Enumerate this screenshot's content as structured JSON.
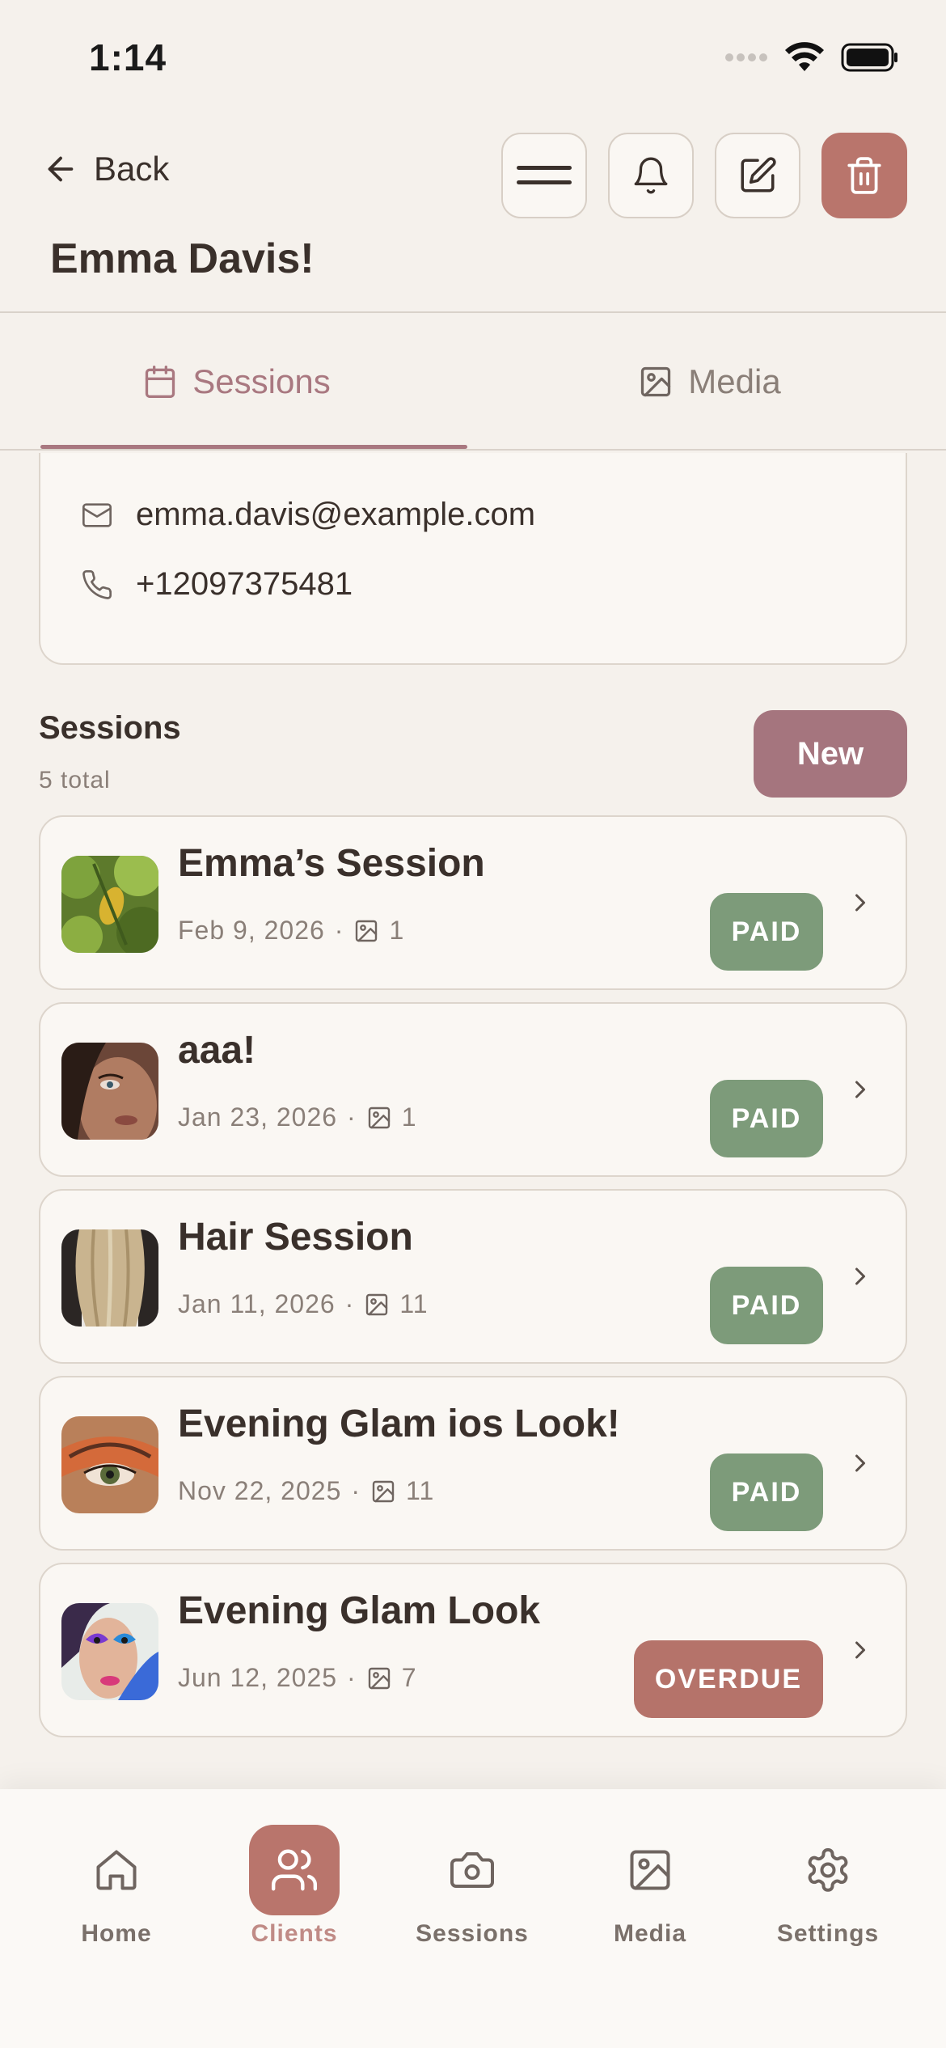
{
  "status_bar": {
    "time": "1:14"
  },
  "header": {
    "back_label": "Back",
    "title": "Emma Davis!",
    "actions": [
      "menu-icon",
      "bell-icon",
      "edit-icon",
      "trash-icon"
    ]
  },
  "tabs": [
    {
      "label": "Sessions",
      "icon": "calendar-icon",
      "active": true
    },
    {
      "label": "Media",
      "icon": "image-icon",
      "active": false
    }
  ],
  "contact": {
    "email": "emma.davis@example.com",
    "phone": "+12097375481"
  },
  "sessions_section": {
    "title": "Sessions",
    "count_label": "5 total",
    "new_button": "New"
  },
  "sessions": [
    {
      "title": "Emma’s Session",
      "date": "Feb 9, 2026",
      "media_count": "1",
      "status": "PAID"
    },
    {
      "title": "aaa!",
      "date": "Jan 23, 2026",
      "media_count": "1",
      "status": "PAID"
    },
    {
      "title": "Hair Session",
      "date": "Jan 11, 2026",
      "media_count": "11",
      "status": "PAID"
    },
    {
      "title": "Evening Glam ios Look!",
      "date": "Nov 22, 2025",
      "media_count": "11",
      "status": "PAID"
    },
    {
      "title": "Evening Glam Look",
      "date": "Jun 12, 2025",
      "media_count": "7",
      "status": "OVERDUE"
    }
  ],
  "bottom_nav": [
    {
      "label": "Home",
      "icon": "home-icon",
      "active": false
    },
    {
      "label": "Clients",
      "icon": "users-icon",
      "active": true
    },
    {
      "label": "Sessions",
      "icon": "camera-icon",
      "active": false
    },
    {
      "label": "Media",
      "icon": "image-icon",
      "active": false
    },
    {
      "label": "Settings",
      "icon": "gear-icon",
      "active": false
    }
  ],
  "colors": {
    "accent": "#a97880",
    "paid": "#7d9b7a",
    "overdue": "#b5736a",
    "danger": "#b9756c",
    "background": "#f5f1ec"
  }
}
